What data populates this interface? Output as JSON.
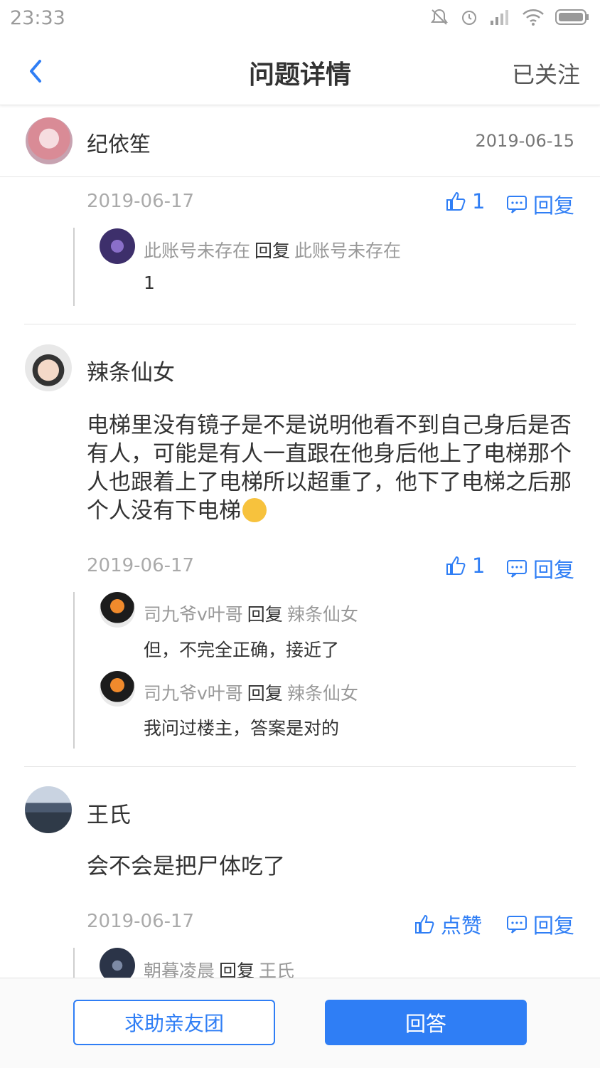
{
  "status_bar": {
    "time": "23:33"
  },
  "header": {
    "title": "问题详情",
    "follow_label": "已关注"
  },
  "asker": {
    "name": "纪依笙",
    "date": "2019-06-15"
  },
  "comments": [
    {
      "date": "2019-06-17",
      "likes": "1",
      "reply_label": "回复",
      "replies": [
        {
          "from": "此账号未存在",
          "verb": "回复",
          "to": "此账号未存在",
          "text": "1"
        }
      ]
    },
    {
      "user": "辣条仙女",
      "content": "电梯里没有镜子是不是说明他看不到自己身后是否有人，可能是有人一直跟在他身后他上了电梯那个人也跟着上了电梯所以超重了，他下了电梯之后那个人没有下电梯",
      "date": "2019-06-17",
      "likes": "1",
      "reply_label": "回复",
      "replies": [
        {
          "from": "司九爷v叶哥",
          "verb": "回复",
          "to": "辣条仙女",
          "text": "但，不完全正确，接近了"
        },
        {
          "from": "司九爷v叶哥",
          "verb": "回复",
          "to": "辣条仙女",
          "text": "我问过楼主，答案是对的"
        }
      ]
    },
    {
      "user": "王氏",
      "content": "会不会是把尸体吃了",
      "date": "2019-06-17",
      "likes": "点赞",
      "reply_label": "回复",
      "replies": [
        {
          "from": "朝暮凌晨",
          "verb": "回复",
          "to": "王氏"
        }
      ]
    }
  ],
  "bottom": {
    "help_label": "求助亲友团",
    "answer_label": "回答"
  },
  "colors": {
    "accent": "#2f7ef5"
  }
}
